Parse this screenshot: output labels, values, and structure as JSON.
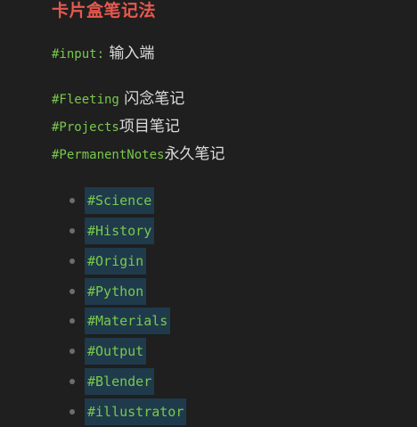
{
  "title": "卡片盒笔记法",
  "input_line": {
    "tag": "#input:",
    "text": " 输入端"
  },
  "note_types": [
    {
      "tag": "#Fleeting",
      "text": " 闪念笔记"
    },
    {
      "tag": "#Projects",
      "text": "项目笔记"
    },
    {
      "tag": "#PermanentNotes",
      "text": "永久笔记"
    }
  ],
  "tag_list": [
    "#Science",
    "#History",
    "#Origin",
    "#Python",
    "#Materials",
    "#Output",
    "#Blender",
    "#illustrator"
  ],
  "colors": {
    "background": "#1f1f1f",
    "title": "#e8584e",
    "tag_text": "#78c94c",
    "chip_background": "#1f3a4b",
    "body_text": "#dcdcdc",
    "bullet": "#6d6d6d"
  }
}
